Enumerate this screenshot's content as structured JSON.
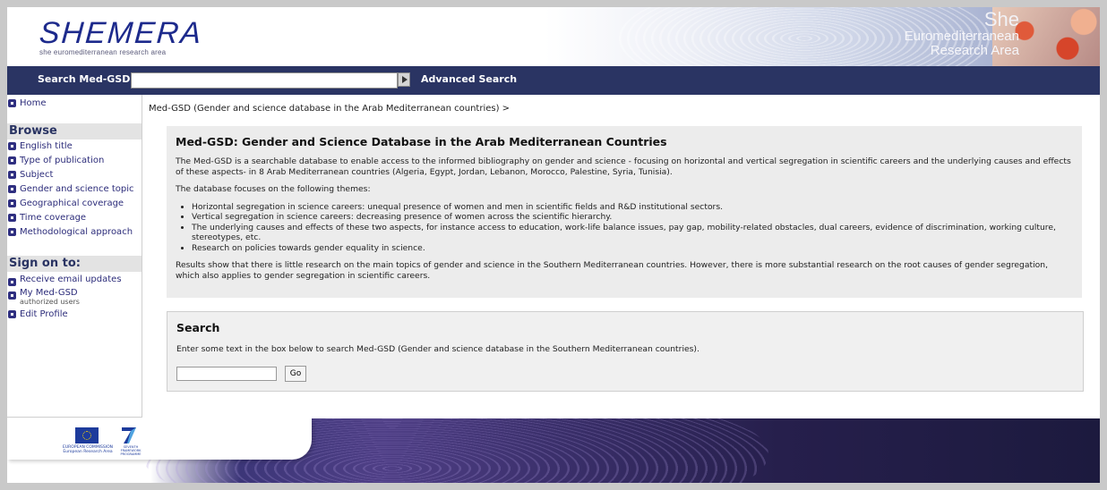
{
  "header": {
    "logo_text": "SHEMERA",
    "logo_subtitle": "she euromediterranean research area",
    "brand_she": "She",
    "brand_line1": "Euromediterranean",
    "brand_line2": "Research Area"
  },
  "nav": {
    "search_label": "Search Med-GSD",
    "search_value": "",
    "advanced_search": "Advanced Search"
  },
  "sidebar": {
    "home": "Home",
    "browse_heading": "Browse",
    "browse_items": [
      "English title",
      "Type of publication",
      "Subject",
      "Gender and science topic",
      "Geographical coverage",
      "Time coverage",
      "Methodological approach"
    ],
    "sign_on_heading": "Sign on to:",
    "receive_email": "Receive email updates",
    "my_medgsd": "My Med-GSD",
    "authorized_users": "authorized users",
    "edit_profile": "Edit Profile"
  },
  "main": {
    "breadcrumb": "Med-GSD (Gender and science database in the Arab Mediterranean countries) >",
    "intro_title": "Med-GSD: Gender and Science Database in the Arab Mediterranean Countries",
    "intro_p1": "The Med-GSD is a searchable database to enable access to the informed bibliography on gender and science - focusing on horizontal and vertical segregation in scientific careers and the underlying causes and effects of these aspects- in 8 Arab Mediterranean countries (Algeria, Egypt, Jordan, Lebanon, Morocco, Palestine, Syria, Tunisia).",
    "intro_p2": "The database focuses on the following themes:",
    "themes": [
      "Horizontal segregation in science careers: unequal presence of women and men in scientific fields and R&D institutional sectors.",
      "Vertical segregation in science careers: decreasing presence of women across the scientific hierarchy.",
      "The underlying causes and effects of these two aspects, for instance access to education, work-life balance issues, pay gap, mobility-related obstacles, dual careers, evidence of discrimination, working culture, stereotypes, etc.",
      "Research on policies towards gender equality in science."
    ],
    "intro_p3": "Results show that there is little research on the main topics of gender and science in the Southern Mediterranean countries. However, there is more substantial research on the root causes of gender segregation, which also applies to gender segregation in scientific careers.",
    "search_title": "Search",
    "search_desc": "Enter some text in the box below to search Med-GSD (Gender and science database in the Southern Mediterranean countries).",
    "search_value": "",
    "go_label": "Go"
  },
  "footer": {
    "eu_label": "EUROPEAN COMMISSION European Research Area",
    "fp7_label": "SEVENTH FRAMEWORK PROGRAMME"
  },
  "colors": {
    "nav_bar": "#2a3463",
    "link": "#2c2c7a",
    "bullet": "#2f2f80",
    "panel": "#ececec"
  }
}
